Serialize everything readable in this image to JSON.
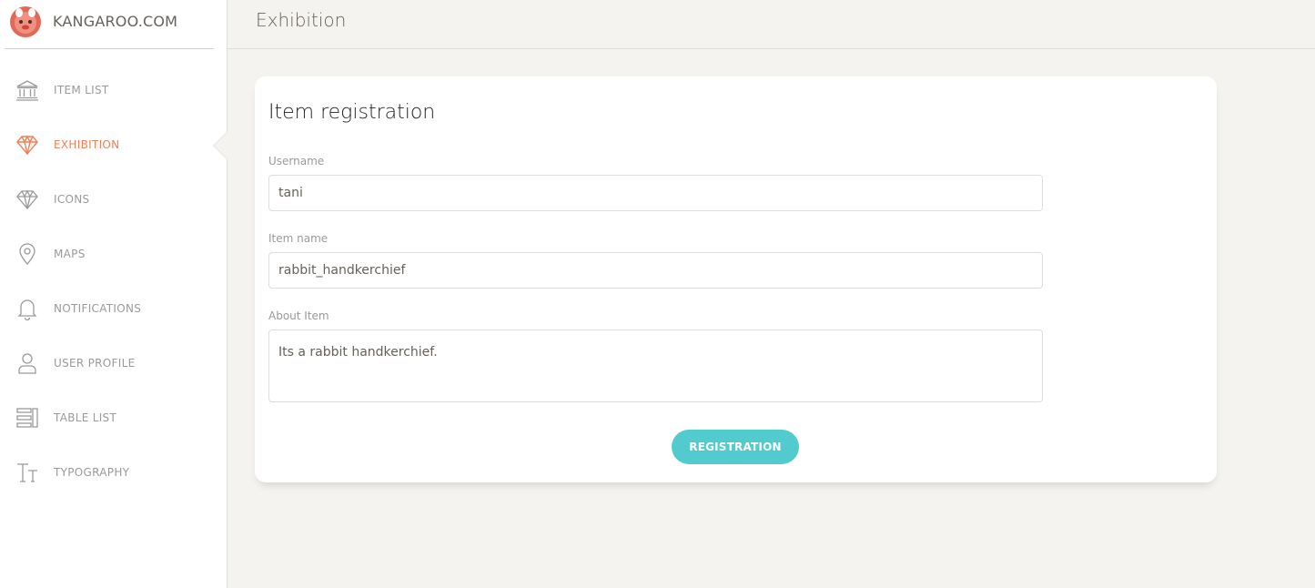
{
  "brand": {
    "name": "KANGAROO.COM",
    "accent_color": "#ef8157"
  },
  "sidebar": {
    "items": [
      {
        "label": "ITEM LIST",
        "icon": "bank-icon",
        "active": false
      },
      {
        "label": "EXHIBITION",
        "icon": "diamond-icon",
        "active": true
      },
      {
        "label": "ICONS",
        "icon": "diamond-icon",
        "active": false
      },
      {
        "label": "MAPS",
        "icon": "map-pin-icon",
        "active": false
      },
      {
        "label": "NOTIFICATIONS",
        "icon": "bell-icon",
        "active": false
      },
      {
        "label": "USER PROFILE",
        "icon": "user-icon",
        "active": false
      },
      {
        "label": "TABLE LIST",
        "icon": "table-list-icon",
        "active": false
      },
      {
        "label": "TYPOGRAPHY",
        "icon": "typography-icon",
        "active": false
      }
    ]
  },
  "header": {
    "title": "Exhibition"
  },
  "form": {
    "title": "Item registration",
    "username_label": "Username",
    "username_value": "tani",
    "item_name_label": "Item name",
    "item_name_value": "rabbit_handkerchief",
    "about_label": "About Item",
    "about_value": "Its a rabbit handkerchief.",
    "submit_label": "REGISTRATION",
    "submit_color": "#51cbce"
  }
}
